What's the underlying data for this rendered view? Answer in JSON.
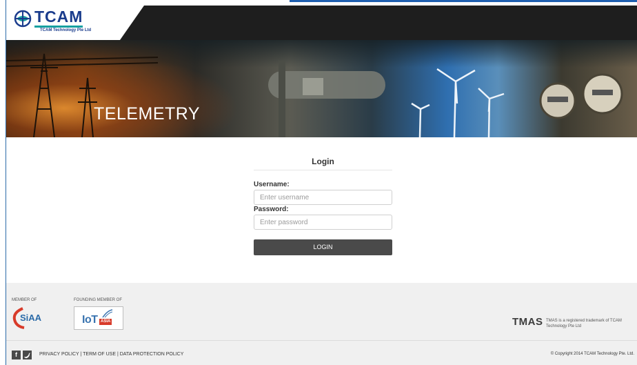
{
  "brand": {
    "logo_word": "TCAM",
    "logo_subtitle": "TCAM Technology Pte Ltd"
  },
  "banner": {
    "title": "TELEMETRY"
  },
  "login": {
    "title": "Login",
    "username_label": "Username:",
    "username_placeholder": "Enter username",
    "password_label": "Password:",
    "password_placeholder": "Enter password",
    "submit_label": "LOGIN"
  },
  "footer": {
    "member_of_label": "MEMBER OF",
    "founding_member_label": "FOUNDING MEMBER OF",
    "siaa_text": "SiAA",
    "iot_text": "IoT",
    "iot_asia_text": "ASIA",
    "tmas_logo": "TMAS",
    "tmas_note": "TMAS is a registered trademark of TCAM Technology Pte Ltd",
    "social": {
      "facebook": "f",
      "twitter": "t"
    },
    "links": "PRIVACY POLICY | TERM OF USE | DATA PROTECTION POLICY",
    "copyright": "© Copyright 2014 TCAM Technology Pte. Ltd."
  },
  "colors": {
    "brand_blue": "#1a3c8c",
    "header_bg": "#1e1e1e",
    "button_bg": "#4a4a4a",
    "footer_bg": "#f0f0f0"
  },
  "icons": {
    "logo": "globe-icon",
    "facebook": "facebook-icon",
    "twitter": "twitter-icon"
  }
}
